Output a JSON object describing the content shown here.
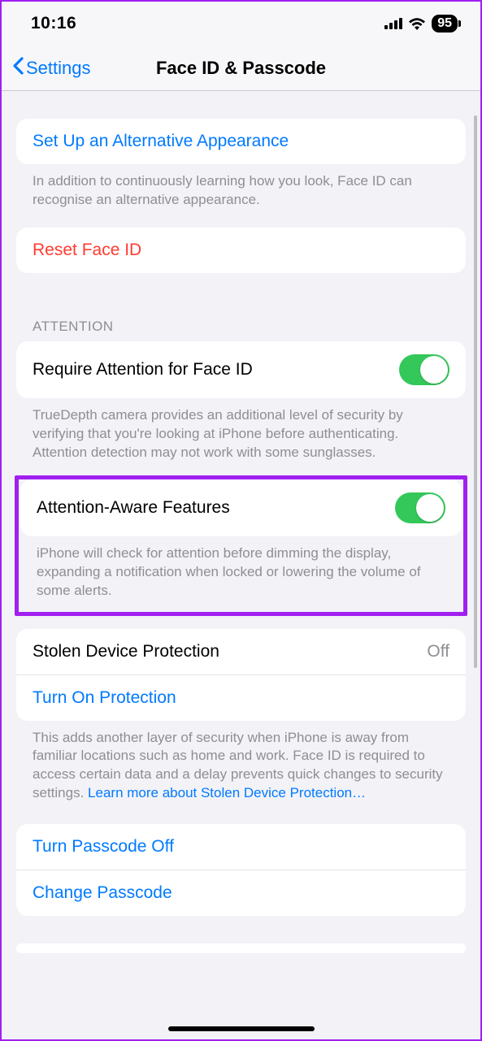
{
  "statusBar": {
    "time": "10:16",
    "battery": "95"
  },
  "nav": {
    "back": "Settings",
    "title": "Face ID & Passcode"
  },
  "sections": {
    "altAppearance": {
      "action": "Set Up an Alternative Appearance",
      "footer": "In addition to continuously learning how you look, Face ID can recognise an alternative appearance."
    },
    "reset": {
      "action": "Reset Face ID"
    },
    "attention": {
      "header": "ATTENTION",
      "requireAttention": {
        "label": "Require Attention for Face ID",
        "footer": "TrueDepth camera provides an additional level of security by verifying that you're looking at iPhone before authenticating. Attention detection may not work with some sunglasses."
      },
      "attentionAware": {
        "label": "Attention-Aware Features",
        "footer": "iPhone will check for attention before dimming the display, expanding a notification when locked or lowering the volume of some alerts."
      }
    },
    "stolen": {
      "label": "Stolen Device Protection",
      "value": "Off",
      "action": "Turn On Protection",
      "footer": "This adds another layer of security when iPhone is away from familiar locations such as home and work. Face ID is required to access certain data and a delay prevents quick changes to security settings. ",
      "learnMore": "Learn more about Stolen Device Protection…"
    },
    "passcode": {
      "turnOff": "Turn Passcode Off",
      "change": "Change Passcode"
    }
  }
}
